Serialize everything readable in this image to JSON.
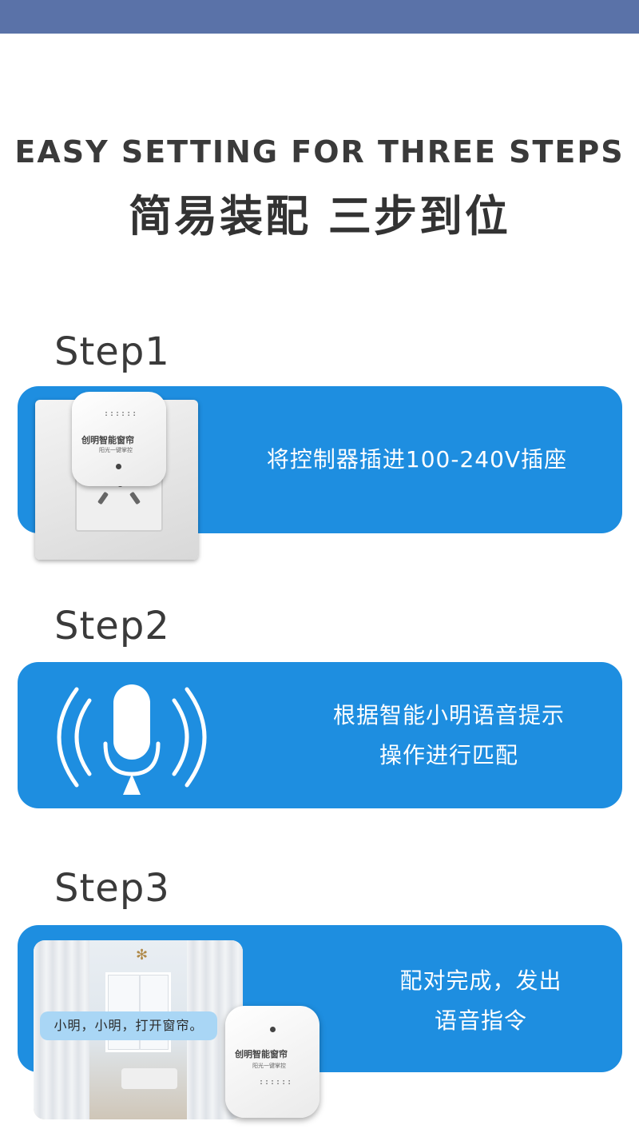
{
  "header": {
    "title_en": "EASY SETTING FOR THREE STEPS",
    "title_cn": "简易装配 三步到位"
  },
  "steps": [
    {
      "label": "Step1",
      "text_lines": [
        "将控制器插进100-240V插座"
      ],
      "device_logo": "创明智能窗帘",
      "device_sub": "阳光一键掌控",
      "image": "socket-with-controller"
    },
    {
      "label": "Step2",
      "text_lines": [
        "根据智能小明语音提示",
        "操作进行匹配"
      ],
      "image": "microphone-icon"
    },
    {
      "label": "Step3",
      "text_lines": [
        "配对完成，发出",
        "语音指令"
      ],
      "bubble": "小明，小明，打开窗帘。",
      "device_logo": "创明智能窗帘",
      "device_sub": "阳光一键掌控",
      "image": "living-room-photo"
    }
  ],
  "colors": {
    "top_bar": "#5a72a8",
    "panel": "#1e8ee0",
    "bubble": "#a9d6f5",
    "text": "#3a3a3a"
  }
}
